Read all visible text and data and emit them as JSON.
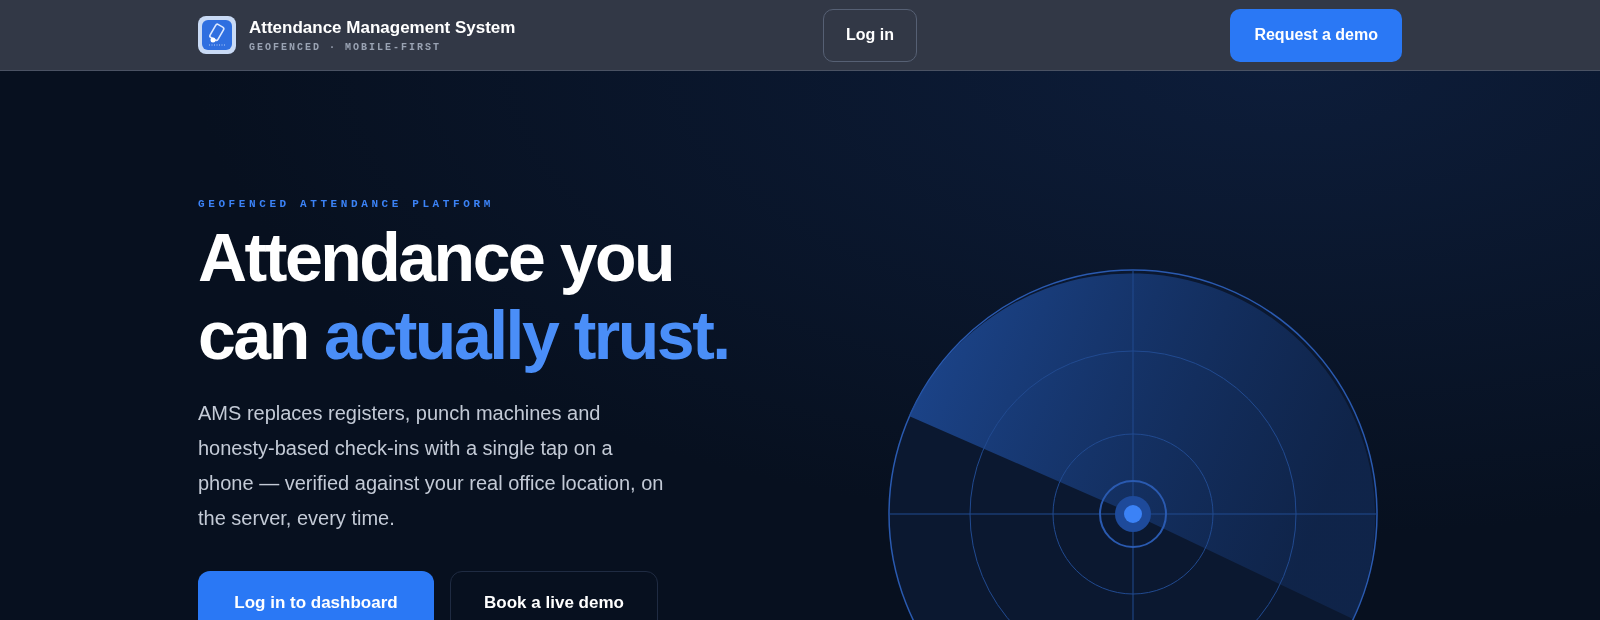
{
  "header": {
    "app_name": "Attendance Management System",
    "tagline": "GEOFENCED · MOBILE-FIRST",
    "login_button": "Log in",
    "demo_button": "Request a demo"
  },
  "hero": {
    "eyebrow": "GEOFENCED ATTENDANCE PLATFORM",
    "heading_line_1": "Attendance you",
    "heading_line_2": "can",
    "heading_accent": "actually trust.",
    "description": "AMS replaces registers, punch machines and honesty-based check-ins with a single tap on a phone — verified against your real office location, on the server, every time.",
    "buttons": [
      {
        "label": "Log in to dashboard",
        "kind": "primary"
      },
      {
        "label": "Book a live demo",
        "kind": "secondary"
      }
    ]
  }
}
